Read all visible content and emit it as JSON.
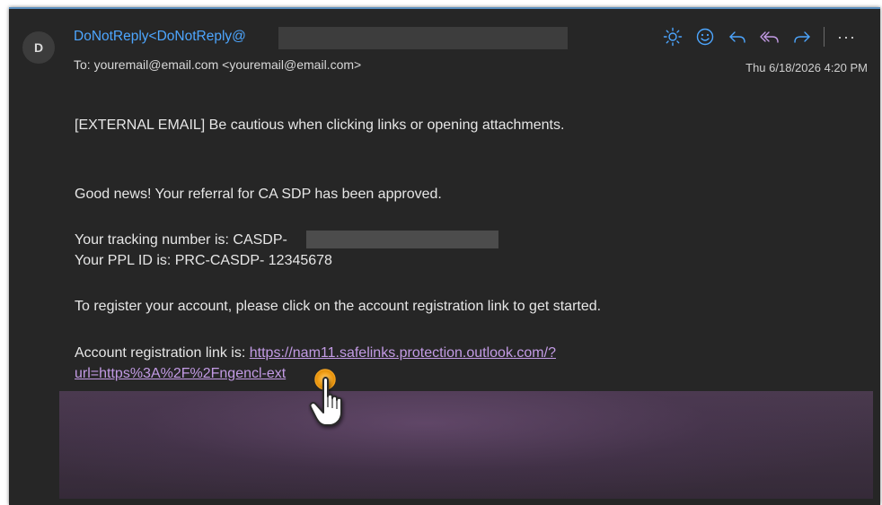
{
  "email": {
    "avatar_letter": "D",
    "sender": "DoNotReply<DoNotReply@",
    "to": "To: youremail@email.com <youremail@email.com>",
    "date": "Thu 6/18/2026 4:20 PM"
  },
  "toolbar": {
    "more_label": "···",
    "icons": [
      "brightness-icon",
      "emoji-icon",
      "reply-icon",
      "reply-all-icon",
      "forward-icon",
      "more-icon"
    ]
  },
  "body": {
    "external_warning": "[EXTERNAL EMAIL] Be cautious when clicking links or opening attachments.",
    "good_news": "Good news! Your referral for CA SDP has been approved.",
    "tracking": "Your tracking number is: CASDP-",
    "ppl_id": "Your PPL ID is: PRC-CASDP- 12345678",
    "register": "To register your account, please click on the account registration link to get started.",
    "account_link_prefix": "Account registration link is: ",
    "account_link_line1": "https://nam11.safelinks.protection.outlook.com/?",
    "account_link_line2": "url=https%3A%2F%2Fngencl-ext"
  },
  "colors": {
    "background": "#262626",
    "sender": "#4da6ff",
    "link": "#c39be5",
    "accent_icon": "#4da6ff",
    "highlight": "#f5a623"
  }
}
